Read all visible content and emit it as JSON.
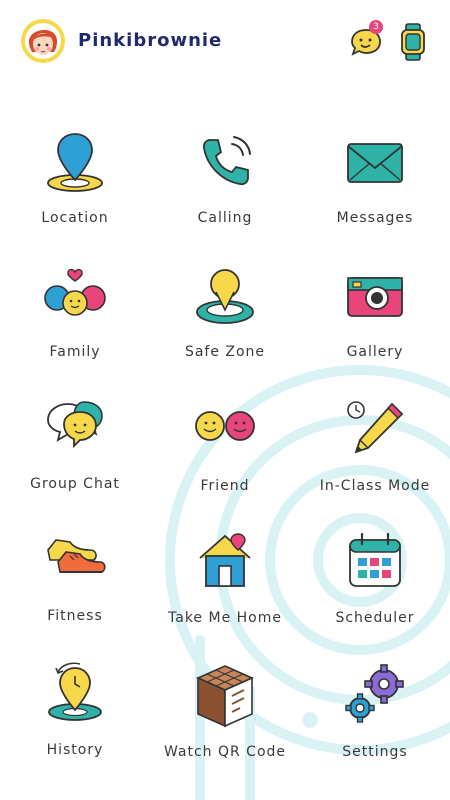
{
  "header": {
    "username": "Pinkibrownie",
    "notification_count": "3"
  },
  "menu": [
    {
      "label": "Location"
    },
    {
      "label": "Calling"
    },
    {
      "label": "Messages"
    },
    {
      "label": "Family"
    },
    {
      "label": "Safe Zone"
    },
    {
      "label": "Gallery"
    },
    {
      "label": "Group Chat"
    },
    {
      "label": "Friend"
    },
    {
      "label": "In-Class Mode"
    },
    {
      "label": "Fitness"
    },
    {
      "label": "Take Me Home"
    },
    {
      "label": "Scheduler"
    },
    {
      "label": "History"
    },
    {
      "label": "Watch QR Code"
    },
    {
      "label": "Settings"
    }
  ],
  "colors": {
    "accent_teal": "#2fb3a8",
    "accent_yellow": "#f7d84a",
    "accent_pink": "#e8457a",
    "username": "#1f2a6b"
  }
}
